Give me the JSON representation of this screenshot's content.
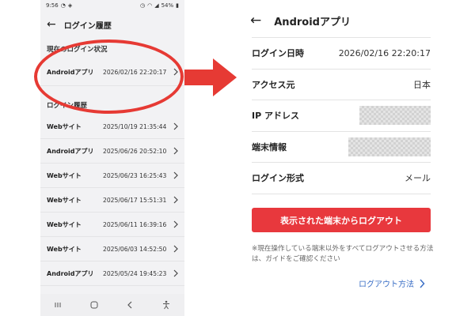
{
  "left": {
    "status_bar": {
      "time": "9:56",
      "battery": "54%"
    },
    "header": {
      "title": "ログイン履歴"
    },
    "current_section_label": "現在のログイン状況",
    "current": {
      "kind": "Androidアプリ",
      "time": "2026/02/16 22:20:17"
    },
    "history_section_label": "ログイン履歴",
    "history": [
      {
        "kind": "Webサイト",
        "time": "2025/10/19 21:35:44"
      },
      {
        "kind": "Androidアプリ",
        "time": "2025/06/26 20:52:10"
      },
      {
        "kind": "Webサイト",
        "time": "2025/06/23 16:25:43"
      },
      {
        "kind": "Webサイト",
        "time": "2025/06/17 15:51:31"
      },
      {
        "kind": "Webサイト",
        "time": "2025/06/11 16:39:16"
      },
      {
        "kind": "Webサイト",
        "time": "2025/06/03 14:52:50"
      },
      {
        "kind": "Androidアプリ",
        "time": "2025/05/24 19:45:23"
      }
    ]
  },
  "right": {
    "header": {
      "title": "Androidアプリ"
    },
    "details": [
      {
        "label": "ログイン日時",
        "value": "2026/02/16 22:20:17"
      },
      {
        "label": "アクセス元",
        "value": "日本"
      },
      {
        "label": "IP アドレス",
        "value": ""
      },
      {
        "label": "端末情報",
        "value": ""
      },
      {
        "label": "ログイン形式",
        "value": "メール"
      }
    ],
    "logout_button": "表示された端末からログアウト",
    "note": "※現在操作している端末以外をすべてログアウトさせる方法は、ガイドをご確認ください",
    "guide_link": "ログアウト方法"
  },
  "colors": {
    "accent_red": "#e8383d",
    "link_blue": "#3b6fc6",
    "highlight_red": "#e63a34"
  }
}
